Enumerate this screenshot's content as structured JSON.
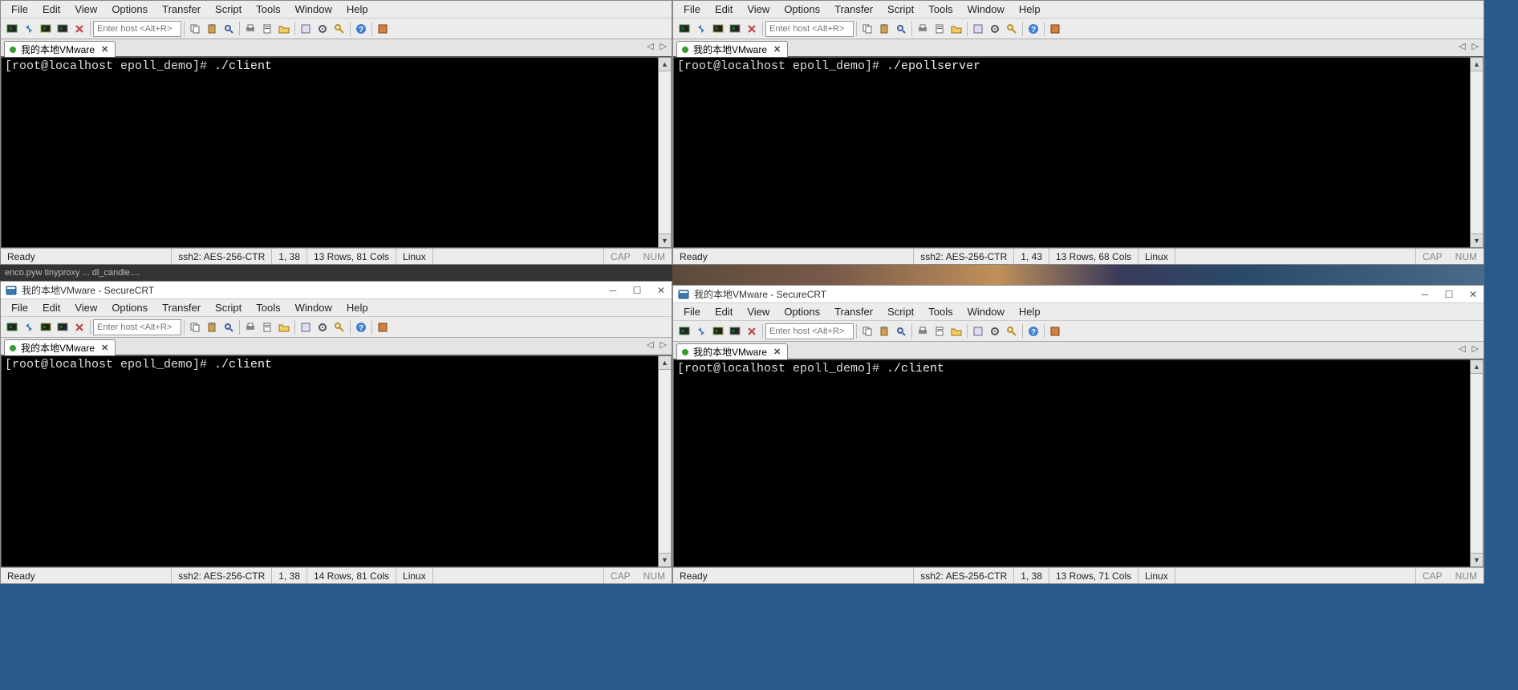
{
  "menus": [
    "File",
    "Edit",
    "View",
    "Options",
    "Transfer",
    "Script",
    "Tools",
    "Window",
    "Help"
  ],
  "host_placeholder": "Enter host <Alt+R>",
  "tab_label": "我的本地VMware",
  "taskstrip": "enco.pyw   tinyproxy ...  dl_candle....",
  "windows": [
    {
      "title": "",
      "prompt": "[root@localhost epoll_demo]# ",
      "command": "./client",
      "status": {
        "ready": "Ready",
        "proto": "ssh2: AES-256-CTR",
        "pos": "1,  38",
        "dims": "13 Rows, 81 Cols",
        "os": "Linux",
        "caps": "CAP",
        "num": "NUM"
      }
    },
    {
      "title": "",
      "prompt": "[root@localhost epoll_demo]# ",
      "command": "./epollserver",
      "status": {
        "ready": "Ready",
        "proto": "ssh2: AES-256-CTR",
        "pos": "1,  43",
        "dims": "13 Rows, 68 Cols",
        "os": "Linux",
        "caps": "CAP",
        "num": "NUM"
      }
    },
    {
      "title": "我的本地VMware - SecureCRT",
      "prompt": "[root@localhost epoll_demo]# ",
      "command": "./client",
      "status": {
        "ready": "Ready",
        "proto": "ssh2: AES-256-CTR",
        "pos": "1,  38",
        "dims": "14 Rows, 81 Cols",
        "os": "Linux",
        "caps": "CAP",
        "num": "NUM"
      }
    },
    {
      "title": "我的本地VMware - SecureCRT",
      "prompt": "[root@localhost epoll_demo]# ",
      "command": "./client",
      "status": {
        "ready": "Ready",
        "proto": "ssh2: AES-256-CTR",
        "pos": "1,  38",
        "dims": "13 Rows, 71 Cols",
        "os": "Linux",
        "caps": "CAP",
        "num": "NUM"
      }
    }
  ]
}
